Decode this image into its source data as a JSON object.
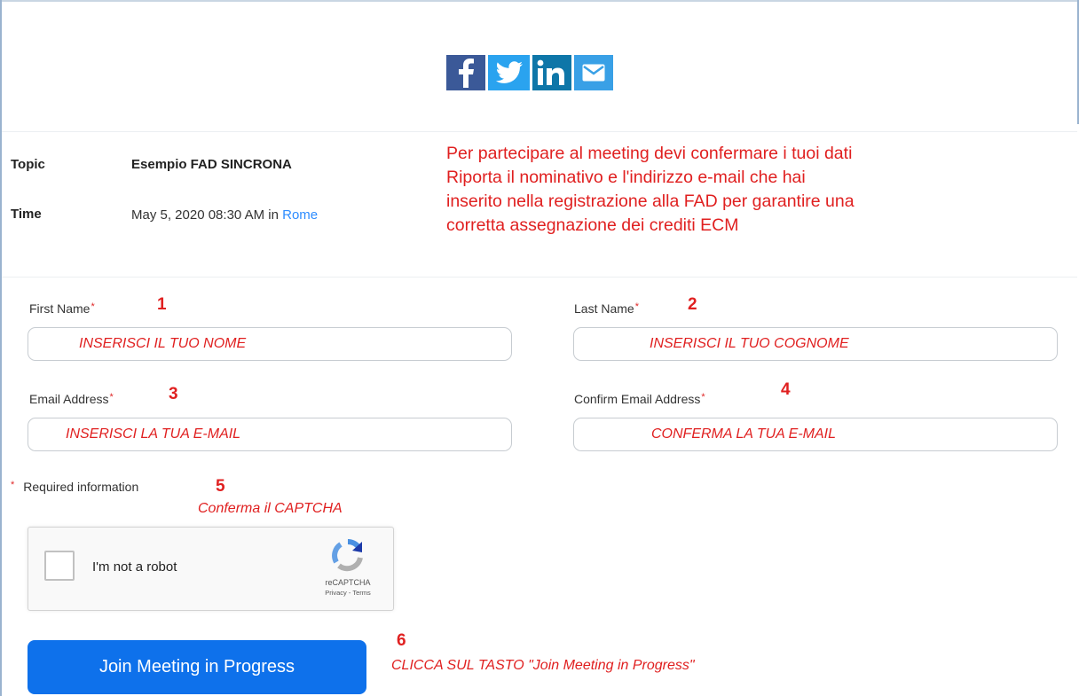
{
  "share": {
    "icons": [
      "facebook-icon",
      "twitter-icon",
      "linkedin-icon",
      "email-icon"
    ],
    "colors": {
      "facebook": "#3b5998",
      "twitter": "#2aa3ef",
      "linkedin": "#0e76a8",
      "email": "#39a0e6"
    }
  },
  "meeting": {
    "topic_label": "Topic",
    "topic_value": "Esempio FAD SINCRONA",
    "time_label": "Time",
    "time_value": "May 5, 2020 08:30 AM in",
    "time_zone_link": "Rome"
  },
  "annotation": {
    "lines": [
      "Per partecipare al meeting devi confermare i tuoi dati",
      "Riporta il nominativo e l'indirizzo e-mail che hai",
      "inserito nella registrazione alla FAD per garantire una",
      "corretta assegnazione dei crediti ECM"
    ],
    "color": "#e02020"
  },
  "form": {
    "first_name": {
      "label": "First Name",
      "step": "1",
      "value": "INSERISCI IL TUO NOME"
    },
    "last_name": {
      "label": "Last Name",
      "step": "2",
      "value": "INSERISCI IL TUO COGNOME"
    },
    "email": {
      "label": "Email Address",
      "step": "3",
      "value": "INSERISCI LA TUA E-MAIL"
    },
    "confirm_email": {
      "label": "Confirm Email Address",
      "step": "4",
      "value": "CONFERMA LA TUA E-MAIL"
    },
    "required_marker": "*",
    "required_info": "Required information",
    "captcha_step": "5",
    "captcha_hint": "Conferma il CAPTCHA"
  },
  "recaptcha": {
    "label": "I'm not a robot",
    "brand": "reCAPTCHA",
    "links": "Privacy - Terms"
  },
  "join": {
    "button_label": "Join Meeting in Progress",
    "button_color": "#0e71eb",
    "step": "6",
    "hint": "CLICCA SUL TASTO \"Join Meeting in Progress\""
  }
}
